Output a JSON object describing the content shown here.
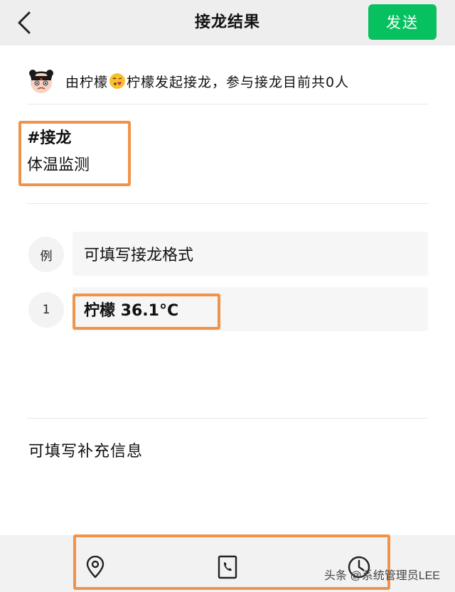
{
  "header": {
    "title": "接龙结果",
    "send_label": "发送"
  },
  "initiator": {
    "prefix": "由柠檬",
    "suffix": "柠檬发起接龙，参与接龙目前共0人"
  },
  "topic": {
    "tag": "#接龙",
    "title": "体温监测"
  },
  "entries": [
    {
      "index": "例",
      "text": "可填写接龙格式"
    },
    {
      "index": "1",
      "text": "柠檬 36.1°C"
    }
  ],
  "supplement": {
    "placeholder": "可填写补充信息"
  },
  "toolbar": {
    "icons": [
      "location-icon",
      "phone-icon",
      "clock-icon"
    ]
  },
  "watermark": "头条 @系统管理员LEE",
  "colors": {
    "accent": "#07c160",
    "highlight": "#f0934a"
  }
}
